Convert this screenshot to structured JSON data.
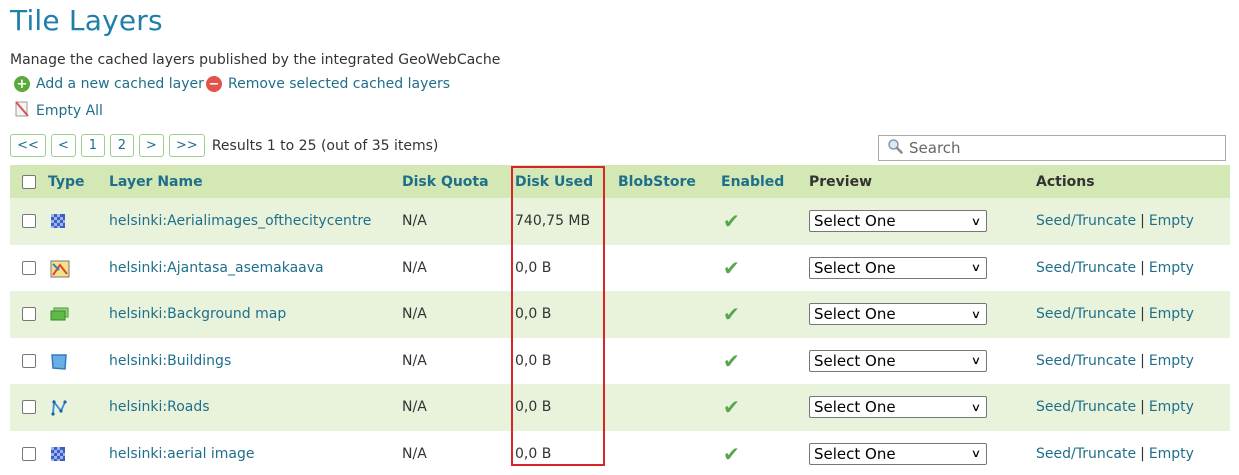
{
  "page": {
    "title": "Tile Layers",
    "description": "Manage the cached layers published by the integrated GeoWebCache"
  },
  "actions": {
    "add": "Add a new cached layer",
    "remove": "Remove selected cached layers",
    "empty_all": "Empty All"
  },
  "pager": {
    "first": "<<",
    "prev": "<",
    "page1": "1",
    "page2": "2",
    "next": ">",
    "last": ">>",
    "results": "Results 1 to 25 (out of 35 items)"
  },
  "search": {
    "placeholder": "Search",
    "icon": "magnifier-icon"
  },
  "table": {
    "headers": {
      "type": "Type",
      "layer_name": "Layer Name",
      "disk_quota": "Disk Quota",
      "disk_used": "Disk Used",
      "blobstore": "BlobStore",
      "enabled": "Enabled",
      "preview": "Preview",
      "actions": "Actions"
    },
    "rows": [
      {
        "type_icon": "raster-icon",
        "name": "helsinki:Aerialimages_ofthecitycentre",
        "quota": "N/A",
        "used": "740,75 MB",
        "blobstore": "",
        "enabled": "✔",
        "preview": "Select One",
        "seed": "Seed/Truncate",
        "sep": "|",
        "empty": "Empty"
      },
      {
        "type_icon": "map-group-icon",
        "name": "helsinki:Ajantasa_asemakaava",
        "quota": "N/A",
        "used": "0,0 B",
        "blobstore": "",
        "enabled": "✔",
        "preview": "Select One",
        "seed": "Seed/Truncate",
        "sep": "|",
        "empty": "Empty"
      },
      {
        "type_icon": "layer-group-icon",
        "name": "helsinki:Background map",
        "quota": "N/A",
        "used": "0,0 B",
        "blobstore": "",
        "enabled": "✔",
        "preview": "Select One",
        "seed": "Seed/Truncate",
        "sep": "|",
        "empty": "Empty"
      },
      {
        "type_icon": "polygon-icon",
        "name": "helsinki:Buildings",
        "quota": "N/A",
        "used": "0,0 B",
        "blobstore": "",
        "enabled": "✔",
        "preview": "Select One",
        "seed": "Seed/Truncate",
        "sep": "|",
        "empty": "Empty"
      },
      {
        "type_icon": "line-icon",
        "name": "helsinki:Roads",
        "quota": "N/A",
        "used": "0,0 B",
        "blobstore": "",
        "enabled": "✔",
        "preview": "Select One",
        "seed": "Seed/Truncate",
        "sep": "|",
        "empty": "Empty"
      },
      {
        "type_icon": "raster-icon",
        "name": "helsinki:aerial image",
        "quota": "N/A",
        "used": "0,0 B",
        "blobstore": "",
        "enabled": "✔",
        "preview": "Select One",
        "seed": "Seed/Truncate",
        "sep": "|",
        "empty": "Empty"
      }
    ]
  },
  "colors": {
    "title": "#1f7fa8",
    "link": "#1f6f8b",
    "header_bg": "#d4e8b6",
    "row_alt_bg": "#e9f3dc",
    "highlight": "#d9242a"
  }
}
